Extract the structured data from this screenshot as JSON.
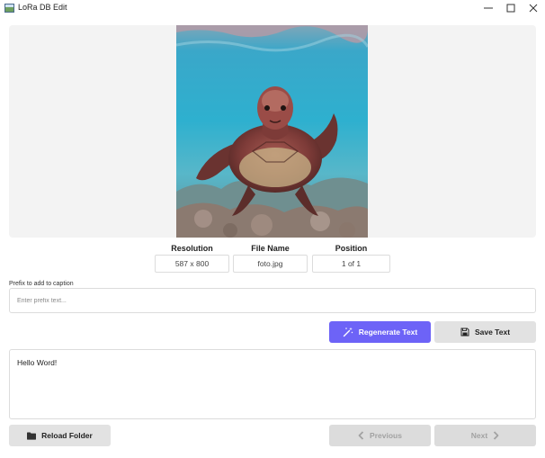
{
  "window": {
    "title": "LoRa DB Edit",
    "controls": [
      "minimize-icon",
      "maximize-icon",
      "close-icon"
    ]
  },
  "image": {
    "subject_icon": "sea-turtle-photo"
  },
  "info": {
    "resolution_label": "Resolution",
    "resolution_value": "587 x 800",
    "filename_label": "File Name",
    "filename_value": "foto.jpg",
    "position_label": "Position",
    "position_value": "1 of 1"
  },
  "prefix": {
    "label": "Prefix to add to caption",
    "placeholder": "Enter prefix text...",
    "value": ""
  },
  "actions": {
    "regenerate_label": "Regenerate Text",
    "regenerate_icon": "magic-wand-icon",
    "save_label": "Save Text",
    "save_icon": "floppy-disk-icon"
  },
  "caption": {
    "text": "Hello Word!"
  },
  "navigation": {
    "reload_label": "Reload Folder",
    "reload_icon": "folder-icon",
    "previous_label": "Previous",
    "previous_icon": "chevron-left-icon",
    "next_label": "Next",
    "next_icon": "chevron-right-icon",
    "previous_enabled": false,
    "next_enabled": false
  },
  "colors": {
    "accent": "#6d63f7",
    "secondary_button": "#e2e2e2",
    "disabled_button": "#dcdcdc",
    "panel_background": "#f3f3f3"
  }
}
